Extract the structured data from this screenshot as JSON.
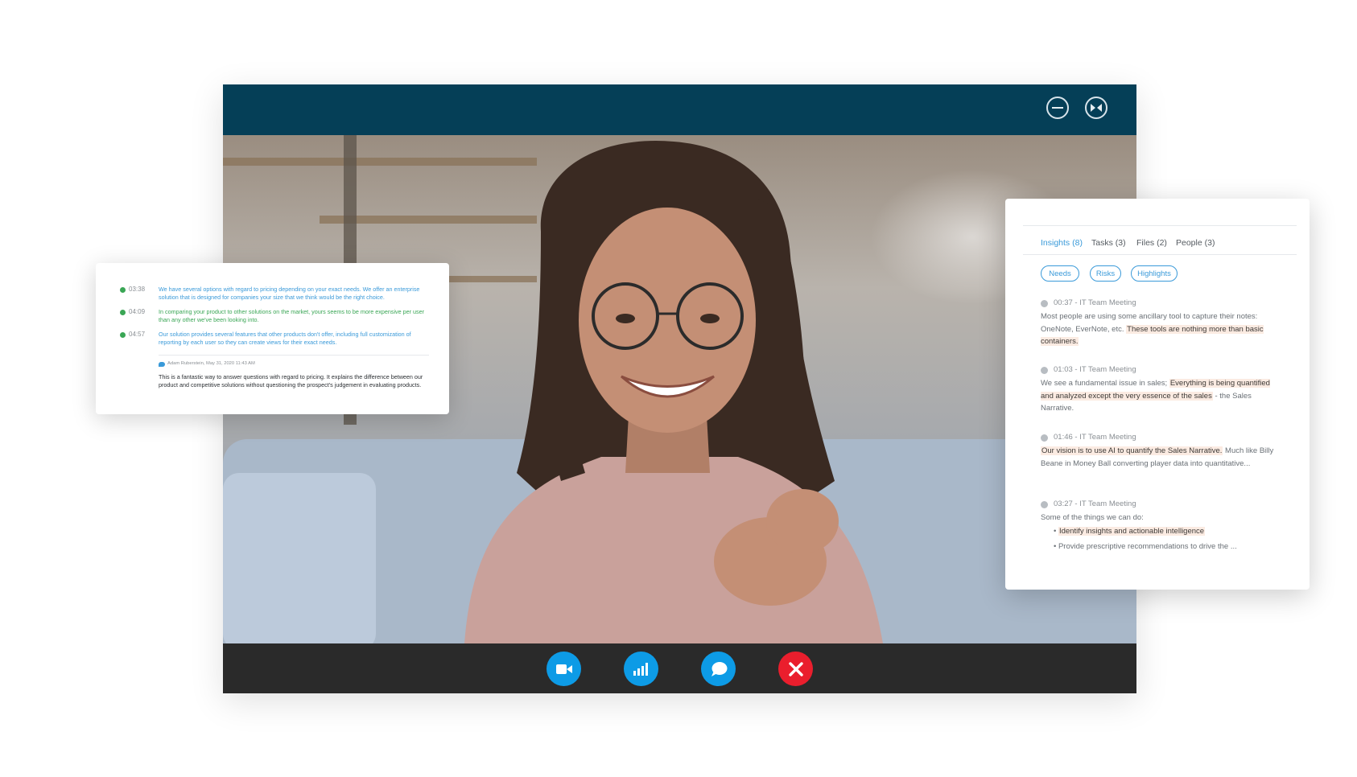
{
  "window": {
    "minimize_icon": "minus-circle-icon",
    "collapse_icon": "collapse-arrows-icon"
  },
  "controls": {
    "camera_icon": "video-camera-icon",
    "stats_icon": "bar-chart-icon",
    "chat_icon": "chat-bubble-icon",
    "end_icon": "close-x-icon",
    "colors": {
      "blue": "#0d9be6",
      "red": "#ea1e2d",
      "bar": "#2a2a2a",
      "header": "#053f57"
    }
  },
  "transcript": {
    "entries": [
      {
        "time": "03:38",
        "text": "We have several options with regard to pricing depending on your exact needs. We offer an enterprise solution that is designed for companies your size that we think would be the right choice."
      },
      {
        "time": "04:09",
        "text": "In comparing your product to other solutions on the market, yours seems to be more expensive per user than any other we've been looking into."
      },
      {
        "time": "04:57",
        "text": "Our solution provides several features that other products don't offer, including full customization of reporting by each user so they can create views for their exact needs."
      }
    ],
    "comment": {
      "author": "Adam Ruberstein, May 31, 2020 11:43 AM",
      "text": "This is a fantastic way to answer questions with regard to pricing. It explains the difference between our product and competitive solutions without questioning the prospect's judgement in evaluating products."
    }
  },
  "insights": {
    "tabs": [
      "Insights (8)",
      "Tasks (3)",
      "Files (2)",
      "People (3)"
    ],
    "filters": [
      "Needs",
      "Risks",
      "Highlights"
    ],
    "items": [
      {
        "header": "00:37 - IT Team Meeting",
        "plain": "Most people are using some ancillary tool to capture their notes:  OneNote, EverNote, etc. ",
        "highlight": "These tools are nothing more than basic containers.",
        "after": ""
      },
      {
        "header": "01:03 - IT Team Meeting",
        "plain": "We see a fundamental issue in sales;  ",
        "highlight": "Everything is being quantified and analyzed except the very essence of the sales",
        "after": " - the Sales Narrative."
      },
      {
        "header": "01:46 - IT Team Meeting",
        "plain": "",
        "highlight": "Our vision is to use AI to quantify the Sales Narrative.",
        "after": "  Much like Billy Beane in Money Ball converting player data into quantitative..."
      },
      {
        "header": "03:27 - IT Team Meeting",
        "plain": "Some of the things we can do:",
        "bullets": [
          {
            "text": "Identify insights and actionable intelligence",
            "highlight": true
          },
          {
            "text": "Provide prescriptive recommendations to drive the ...",
            "highlight": false
          }
        ]
      }
    ]
  }
}
